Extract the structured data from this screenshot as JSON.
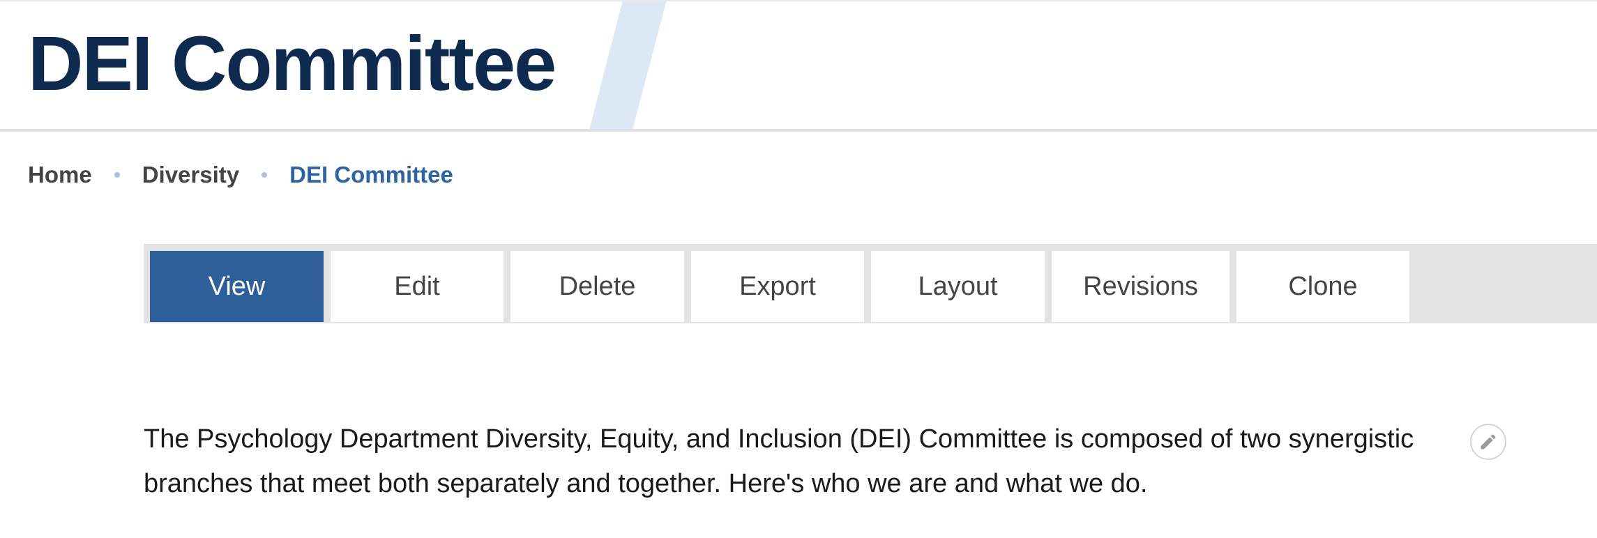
{
  "header": {
    "title": "DEI Committee",
    "accent_color": "#0e2a4f",
    "stripe_color": "#dce8f5"
  },
  "breadcrumb": {
    "items": [
      {
        "label": "Home"
      },
      {
        "label": "Diversity"
      },
      {
        "label": "DEI Committee"
      }
    ],
    "current_color": "#2f64a3"
  },
  "tabs": {
    "active_color": "#2e5f98",
    "items": [
      {
        "label": "View",
        "active": true
      },
      {
        "label": "Edit",
        "active": false
      },
      {
        "label": "Delete",
        "active": false
      },
      {
        "label": "Export",
        "active": false
      },
      {
        "label": "Layout",
        "active": false
      },
      {
        "label": "Revisions",
        "active": false
      },
      {
        "label": "Clone",
        "active": false
      }
    ]
  },
  "content": {
    "line_1": "The Psychology Department Diversity, Equity, and Inclusion (DEI) Committee is composed of two synergistic",
    "line_2": "branches that meet both separately and together. Here's who we are and what we do.",
    "edit_icon": "pencil-icon"
  }
}
